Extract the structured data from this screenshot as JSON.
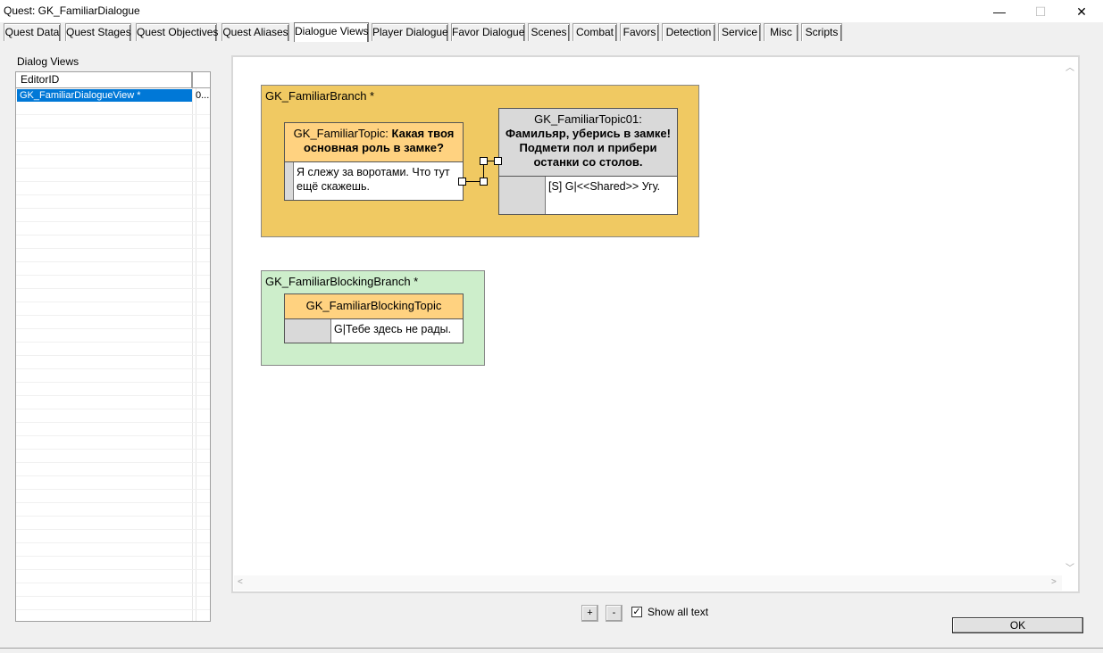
{
  "window": {
    "title": "Quest: GK_FamiliarDialogue",
    "minimize_glyph": "—",
    "maximize_glyph": "☐",
    "close_glyph": "✕"
  },
  "tabs": [
    {
      "label": "Quest Data"
    },
    {
      "label": "Quest Stages"
    },
    {
      "label": "Quest Objectives"
    },
    {
      "label": "Quest Aliases"
    },
    {
      "label": "Dialogue Views",
      "active": true
    },
    {
      "label": "Player Dialogue"
    },
    {
      "label": "Favor Dialogue"
    },
    {
      "label": "Scenes"
    },
    {
      "label": "Combat"
    },
    {
      "label": "Favors"
    },
    {
      "label": "Detection"
    },
    {
      "label": "Service"
    },
    {
      "label": "Misc"
    },
    {
      "label": "Scripts"
    }
  ],
  "dialog_views": {
    "label": "Dialog Views",
    "columns": [
      "EditorID",
      ""
    ],
    "rows": [
      {
        "editor_id": "GK_FamiliarDialogueView *",
        "col2": "0..."
      }
    ]
  },
  "canvas": {
    "branches": [
      {
        "title": "GK_FamiliarBranch *",
        "color": "#f0c962",
        "topics": [
          {
            "name": "GK_FamiliarTopic:",
            "prompt": "Какая твоя основная роль в замке?",
            "response": "Я слежу за воротами. Что тут ещё скажешь."
          },
          {
            "name": "GK_FamiliarTopic01:",
            "prompt": "Фамильяр, уберись в замке! Подмети пол и прибери останки со столов.",
            "response": "[S] G|<<Shared>> Угу."
          }
        ]
      },
      {
        "title": "GK_FamiliarBlockingBranch *",
        "color": "#cdeecb",
        "topics": [
          {
            "name": "GK_FamiliarBlockingTopic",
            "response": "G|Тебе здесь не рады."
          }
        ]
      }
    ]
  },
  "controls": {
    "zoom_in": "+",
    "zoom_out": "-",
    "show_all_text_label": "Show all text",
    "show_all_text_checked": true,
    "check_glyph": "✓",
    "ok_label": "OK"
  }
}
